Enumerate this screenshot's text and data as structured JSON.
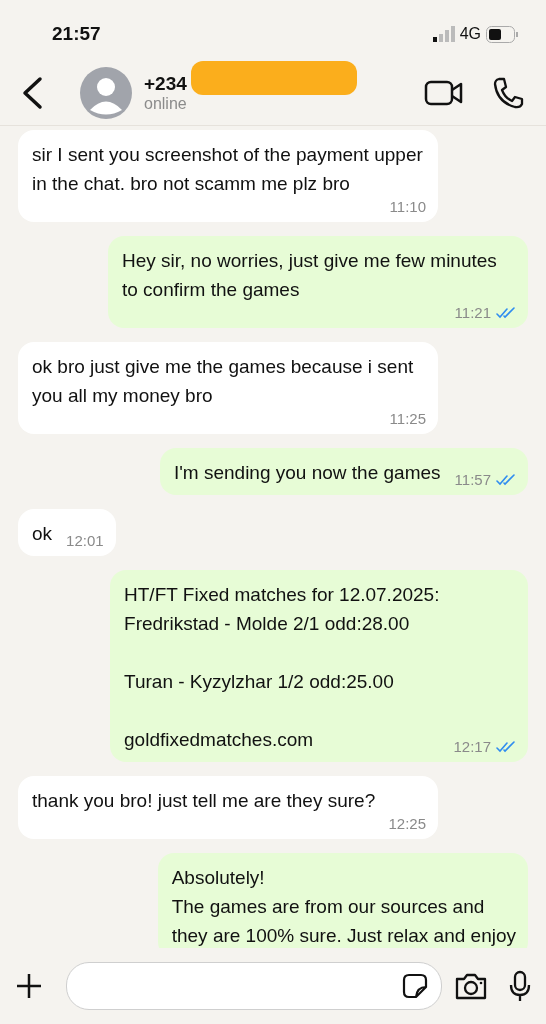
{
  "status_bar": {
    "time": "21:57",
    "network": "4G"
  },
  "header": {
    "name": "+234",
    "status": "online",
    "redacted": true
  },
  "messages": [
    {
      "kind": "incoming",
      "text": "sir I sent you screenshot of the payment upper in the chat. bro not scamm me plz bro",
      "time": "11:10"
    },
    {
      "kind": "outgoing",
      "text": "Hey sir, no worries, just give me few minutes to confirm the games",
      "time": "11:21",
      "read": true
    },
    {
      "kind": "incoming",
      "text": "ok bro just give me the games because i sent you all my money bro",
      "time": "11:25"
    },
    {
      "kind": "outgoing",
      "text": "I'm sending you now the games",
      "time": "11:57",
      "read": true
    },
    {
      "kind": "incoming",
      "text": "ok",
      "time": "12:01"
    },
    {
      "kind": "outgoing",
      "text": "HT/FT Fixed matches for 12.07.2025:\nFredrikstad - Molde 2/1 odd:28.00\n\nTuran - Kyzylzhar 1/2 odd:25.00\n\ngoldfixedmatches.com",
      "time": "12:17",
      "read": true
    },
    {
      "kind": "incoming",
      "text": "thank you bro! just tell me are they sure?",
      "time": "12:25"
    },
    {
      "kind": "outgoing",
      "text": "Absolutely!\nThe games are from our sources and\nthey are 100% sure. Just relax and enjoy"
    }
  ]
}
